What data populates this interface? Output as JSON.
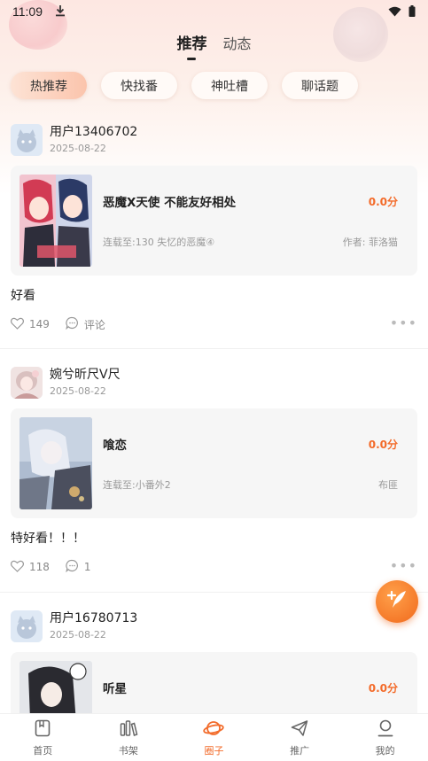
{
  "status_bar": {
    "time": "11:09"
  },
  "top_tabs": [
    {
      "label": "推荐",
      "active": true
    },
    {
      "label": "动态",
      "active": false
    }
  ],
  "chips": [
    {
      "label": "热推荐",
      "active": true
    },
    {
      "label": "快找番",
      "active": false
    },
    {
      "label": "神吐槽",
      "active": false
    },
    {
      "label": "聊话题",
      "active": false
    }
  ],
  "posts": [
    {
      "user": "用户13406702",
      "date": "2025-08-22",
      "book_title": "恶魔X天使 不能友好相处",
      "score": "0.0分",
      "serial": "连载至:130 失忆的恶魔④",
      "author": "作者: 菲洛猫",
      "text": "好看",
      "likes": "149",
      "comments": "评论"
    },
    {
      "user": "婉兮昕尺V尺",
      "date": "2025-08-22",
      "book_title": "喰恋",
      "score": "0.0分",
      "serial": "连载至:小番外2",
      "author": "布匪",
      "text": "特好看！！！",
      "likes": "118",
      "comments": "1"
    },
    {
      "user": "用户16780713",
      "date": "2025-08-22",
      "book_title": "听星",
      "score": "0.0分"
    }
  ],
  "bottom_nav": [
    {
      "label": "首页",
      "icon": "home-icon",
      "active": false
    },
    {
      "label": "书架",
      "icon": "bookshelf-icon",
      "active": false
    },
    {
      "label": "圈子",
      "icon": "planet-icon",
      "active": true
    },
    {
      "label": "推广",
      "icon": "paper-plane-icon",
      "active": false
    },
    {
      "label": "我的",
      "icon": "profile-icon",
      "active": false
    }
  ],
  "colors": {
    "accent": "#f26b2a",
    "score": "#f36b2a"
  }
}
